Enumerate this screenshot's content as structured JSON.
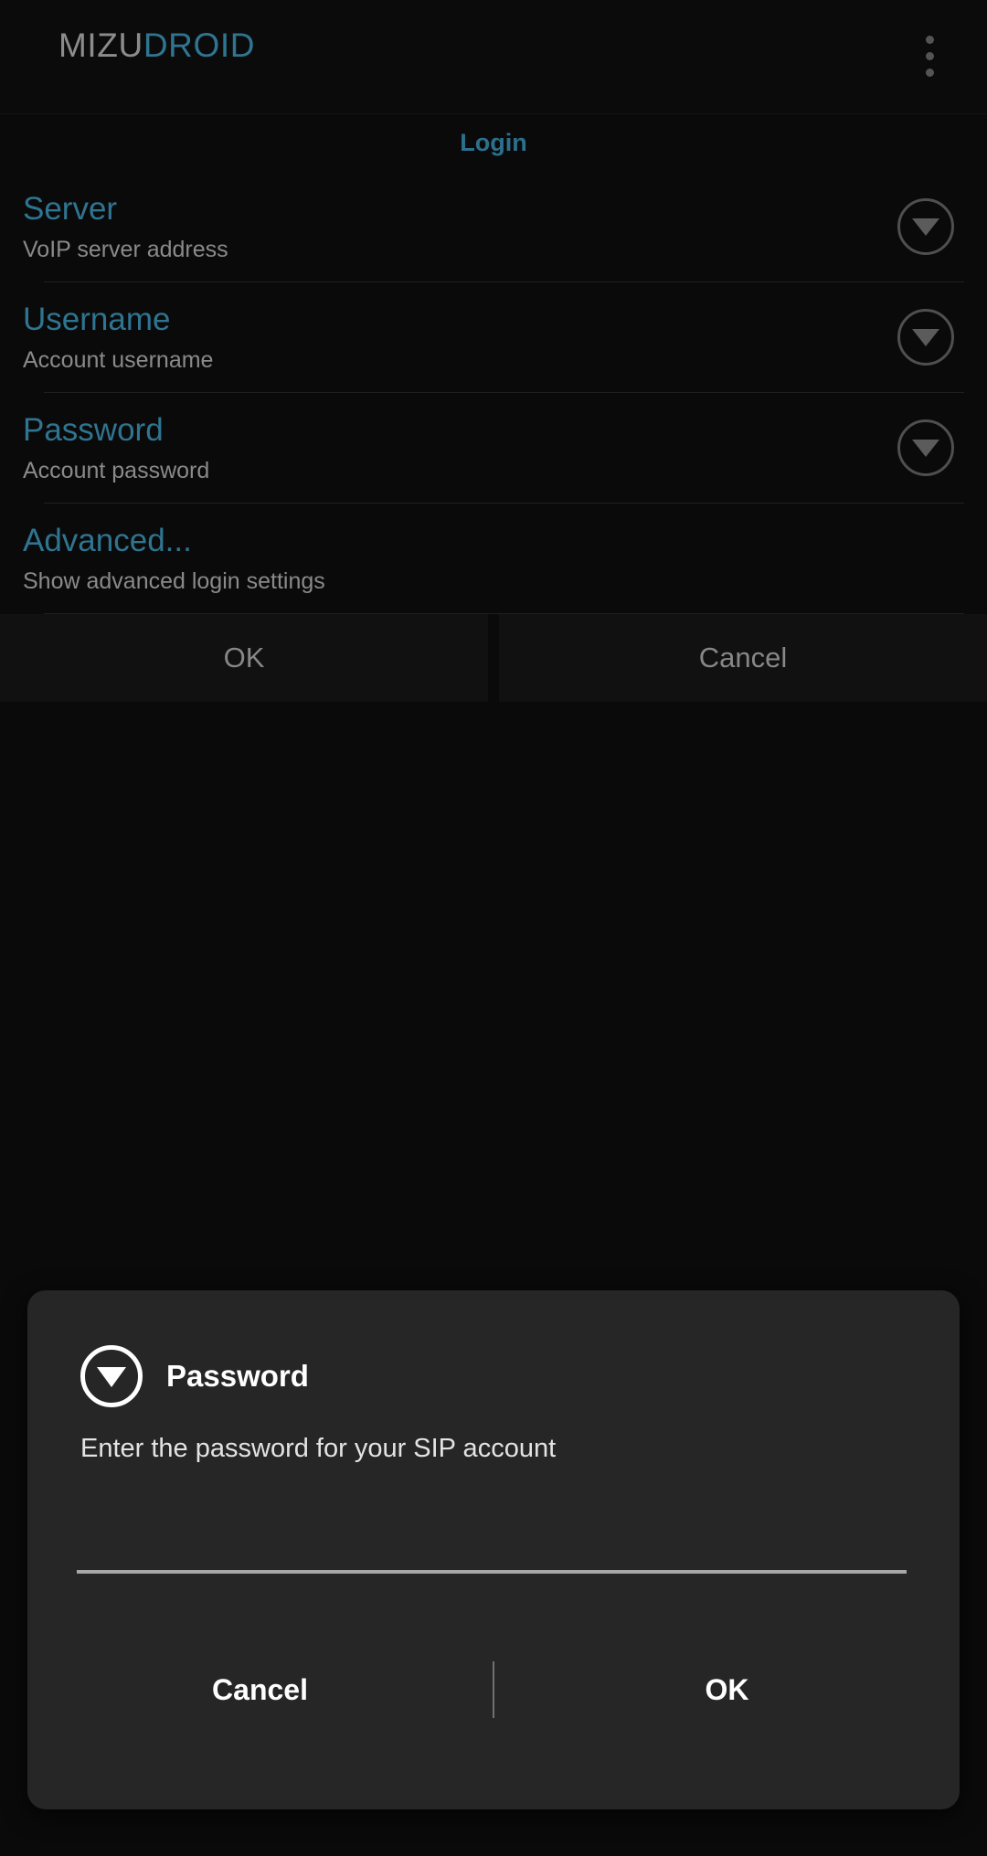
{
  "app": {
    "title_primary": "MIZU",
    "title_accent": "DROID",
    "overflow_icon": "overflow-menu-icon",
    "accent_color": "#2f7490",
    "background_color": "#0a0a0a"
  },
  "page": {
    "title": "Login"
  },
  "preferences": [
    {
      "title": "Server",
      "summary": "VoIP server address",
      "widget_icon": "circle-down-caret-icon",
      "has_widget": true
    },
    {
      "title": "Username",
      "summary": "Account username",
      "widget_icon": "circle-down-caret-icon",
      "has_widget": true
    },
    {
      "title": "Password",
      "summary": "Account password",
      "widget_icon": "circle-down-caret-icon",
      "has_widget": true
    },
    {
      "title": "Advanced...",
      "summary": "Show advanced login settings",
      "widget_icon": "",
      "has_widget": false
    }
  ],
  "button_bar": {
    "ok_label": "OK",
    "cancel_label": "Cancel"
  },
  "dialog": {
    "icon": "circle-down-caret-icon",
    "title": "Password",
    "message": "Enter the password for your SIP account",
    "input_value": "",
    "input_placeholder": "",
    "cancel_label": "Cancel",
    "ok_label": "OK",
    "background_color": "#262626"
  }
}
